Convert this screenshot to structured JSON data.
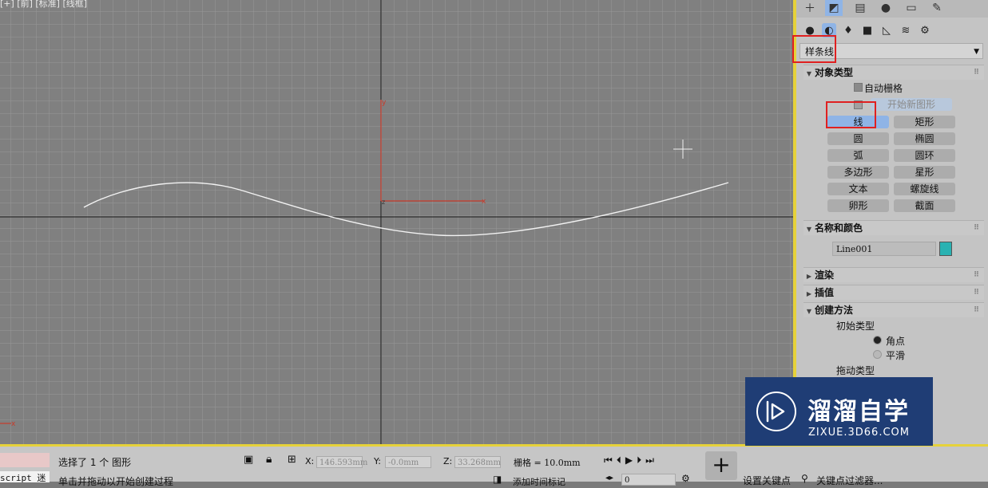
{
  "viewport": {
    "label": "[+] [前] [标准] [线框]",
    "axis_x": "x",
    "axis_y": "y",
    "axis_z": "z",
    "corner_axis_x": "x"
  },
  "command_panel": {
    "tabs": [
      "create-icon",
      "modify-icon",
      "hierarchy-icon",
      "motion-icon",
      "display-icon",
      "utilities-icon"
    ],
    "subtabs": [
      "geometry-icon",
      "shapes-icon",
      "lights-icon",
      "cameras-icon",
      "helpers-icon",
      "spacewarps-icon",
      "systems-icon"
    ],
    "category": "样条线",
    "object_type": {
      "title": "对象类型",
      "auto_grid": "自动栅格",
      "start_new_shape": "开始新图形",
      "buttons": [
        "线",
        "矩形",
        "圆",
        "椭圆",
        "弧",
        "圆环",
        "多边形",
        "星形",
        "文本",
        "螺旋线",
        "卵形",
        "截面"
      ],
      "active": "线"
    },
    "name_color": {
      "title": "名称和颜色",
      "name": "Line001",
      "color": "#2ab2b2"
    },
    "rendering": {
      "title": "渲染"
    },
    "interpolation": {
      "title": "插值"
    },
    "creation_method": {
      "title": "创建方法",
      "initial_type": "初始类型",
      "corner": "角点",
      "smooth": "平滑",
      "drag_type": "拖动类型"
    }
  },
  "statusbar": {
    "script_label": "script 迷",
    "selection": "选择了 1 个 图形",
    "prompt": "单击并拖动以开始创建过程",
    "x_label": "X:",
    "x_value": "146.593mm",
    "y_label": "Y:",
    "y_value": "-0.0mm",
    "z_label": "Z:",
    "z_value": "33.268mm",
    "grid": "栅格 = 10.0mm",
    "add_time_tag": "添加时间标记",
    "frame": "0",
    "set_key": "设置关键点",
    "key_filters": "关键点过滤器..."
  },
  "watermark": {
    "title": "溜溜自学",
    "url": "ZIXUE.3D66.COM"
  }
}
